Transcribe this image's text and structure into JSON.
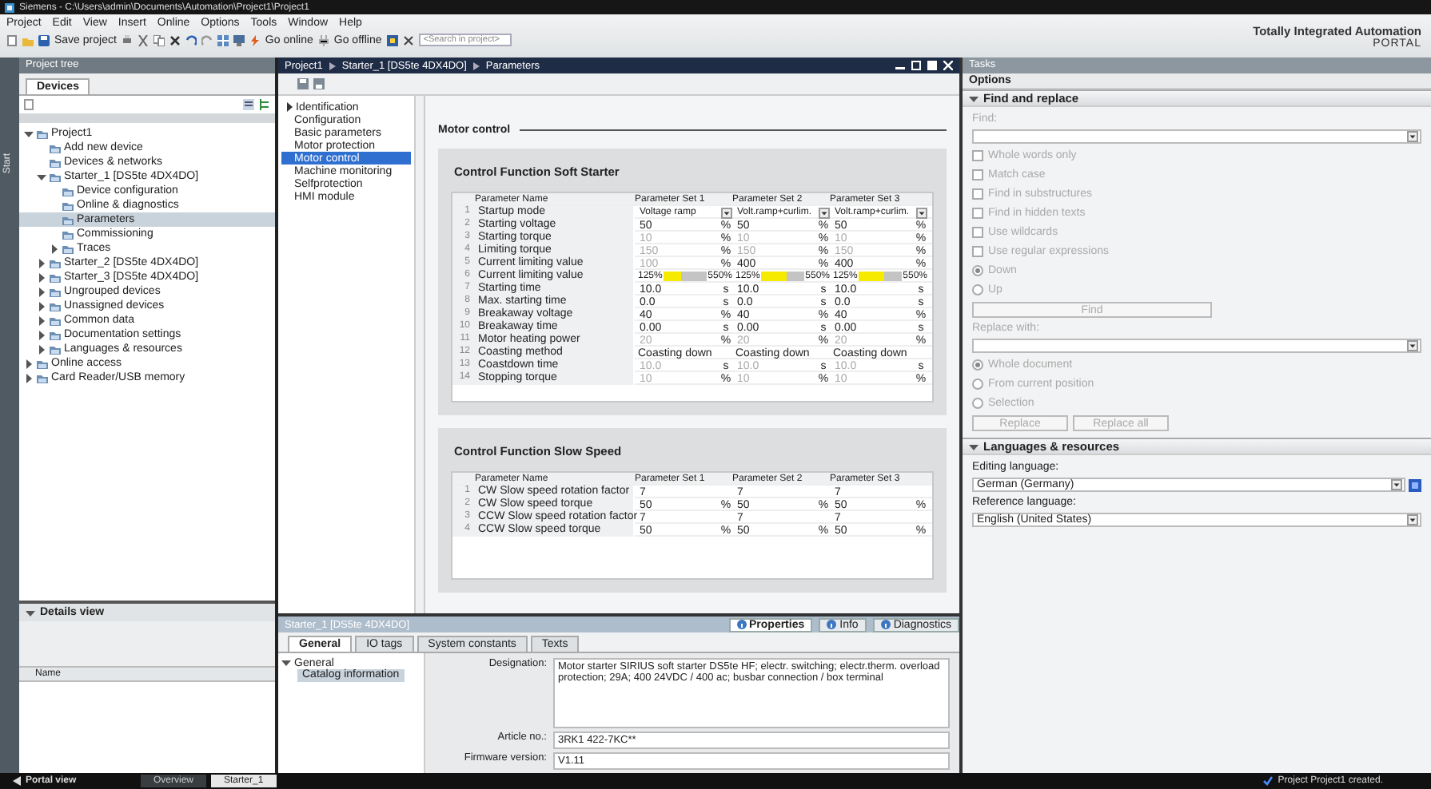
{
  "window": {
    "title": "Siemens - C:\\Users\\admin\\Documents\\Automation\\Project1\\Project1"
  },
  "menu": [
    "Project",
    "Edit",
    "View",
    "Insert",
    "Online",
    "Options",
    "Tools",
    "Window",
    "Help"
  ],
  "toolbar": {
    "save": "Save project",
    "go_online": "Go online",
    "go_offline": "Go offline",
    "search": {
      "placeholder": "<Search in project>"
    }
  },
  "brand": {
    "line1": "Totally Integrated Automation",
    "line2": "PORTAL"
  },
  "start_tab": "Start",
  "project_tree": {
    "title": "Project tree",
    "tabs": [
      {
        "label": "Devices",
        "selected": true
      }
    ],
    "items": [
      {
        "label": "Project1",
        "expanded": true,
        "selected": false,
        "children": [
          {
            "label": "Add new device",
            "selected": false
          },
          {
            "label": "Devices & networks",
            "selected": false
          },
          {
            "label": "Starter_1 [DS5te 4DX4DO]",
            "expanded": true,
            "selected": false,
            "children": [
              {
                "label": "Device configuration",
                "selected": false
              },
              {
                "label": "Online & diagnostics",
                "selected": false
              },
              {
                "label": "Parameters",
                "selected": true
              },
              {
                "label": "Commissioning",
                "selected": false
              },
              {
                "label": "Traces",
                "expanded": false,
                "selected": false
              }
            ]
          },
          {
            "label": "Starter_2 [DS5te 4DX4DO]",
            "expanded": false,
            "selected": false
          },
          {
            "label": "Starter_3 [DS5te 4DX4DO]",
            "expanded": false,
            "selected": false
          },
          {
            "label": "Ungrouped devices",
            "expanded": false,
            "selected": false
          },
          {
            "label": "Unassigned devices",
            "expanded": false,
            "selected": false
          },
          {
            "label": "Common data",
            "expanded": false,
            "selected": false
          },
          {
            "label": "Documentation settings",
            "expanded": false,
            "selected": false
          },
          {
            "label": "Languages & resources",
            "expanded": false,
            "selected": false
          }
        ]
      },
      {
        "label": "Online access",
        "expanded": false,
        "selected": false
      },
      {
        "label": "Card Reader/USB memory",
        "expanded": false,
        "selected": false
      }
    ]
  },
  "details_view": {
    "title": "Details view",
    "expanded": true,
    "columns": [
      "Name"
    ]
  },
  "editor": {
    "breadcrumb": [
      "Project1",
      "Starter_1 [DS5te 4DX4DO]",
      "Parameters"
    ],
    "nav": [
      {
        "label": "Identification",
        "expandable": true,
        "selected": false
      },
      {
        "label": "Configuration",
        "expandable": false,
        "selected": false
      },
      {
        "label": "Basic parameters",
        "expandable": false,
        "selected": false
      },
      {
        "label": "Motor protection",
        "expandable": false,
        "selected": false
      },
      {
        "label": "Motor control",
        "expandable": false,
        "selected": true
      },
      {
        "label": "Machine monitoring",
        "expandable": false,
        "selected": false
      },
      {
        "label": "Selfprotection",
        "expandable": false,
        "selected": false
      },
      {
        "label": "HMI module",
        "expandable": false,
        "selected": false
      }
    ],
    "heading": "Motor control",
    "sections": [
      {
        "title": "Control Function Soft Starter",
        "columns": [
          "Parameter Name",
          "Parameter Set 1",
          "Parameter Set 2",
          "Parameter Set 3"
        ],
        "rows": [
          {
            "no": "1",
            "name": "Startup mode",
            "kind": "dropdown",
            "sets": [
              {
                "value": "Voltage ramp"
              },
              {
                "value": "Volt.ramp+curlim."
              },
              {
                "value": "Volt.ramp+curlim."
              }
            ]
          },
          {
            "no": "2",
            "name": "Starting voltage",
            "kind": "value",
            "sets": [
              {
                "value": "50",
                "unit": "%",
                "disabled": false
              },
              {
                "value": "50",
                "unit": "%",
                "disabled": false
              },
              {
                "value": "50",
                "unit": "%",
                "disabled": false
              }
            ]
          },
          {
            "no": "3",
            "name": "Starting torque",
            "kind": "value",
            "sets": [
              {
                "value": "10",
                "unit": "%",
                "disabled": true
              },
              {
                "value": "10",
                "unit": "%",
                "disabled": true
              },
              {
                "value": "10",
                "unit": "%",
                "disabled": true
              }
            ]
          },
          {
            "no": "4",
            "name": "Limiting torque",
            "kind": "value",
            "sets": [
              {
                "value": "150",
                "unit": "%",
                "disabled": true
              },
              {
                "value": "150",
                "unit": "%",
                "disabled": true
              },
              {
                "value": "150",
                "unit": "%",
                "disabled": true
              }
            ]
          },
          {
            "no": "5",
            "name": "Current limiting value",
            "kind": "value",
            "sets": [
              {
                "value": "100",
                "unit": "%",
                "disabled": true
              },
              {
                "value": "400",
                "unit": "%",
                "disabled": false
              },
              {
                "value": "400",
                "unit": "%",
                "disabled": false
              }
            ]
          },
          {
            "no": "6",
            "name": "Current limiting value",
            "kind": "range",
            "sets": [
              {
                "min": "125%",
                "max": "550%",
                "level": 0.4
              },
              {
                "min": "125%",
                "max": "550%",
                "level": 0.6
              },
              {
                "min": "125%",
                "max": "550%",
                "level": 0.6
              }
            ]
          },
          {
            "no": "7",
            "name": "Starting time",
            "kind": "value",
            "sets": [
              {
                "value": "10.0",
                "unit": "s",
                "disabled": false
              },
              {
                "value": "10.0",
                "unit": "s",
                "disabled": false
              },
              {
                "value": "10.0",
                "unit": "s",
                "disabled": false
              }
            ]
          },
          {
            "no": "8",
            "name": "Max. starting time",
            "kind": "value",
            "sets": [
              {
                "value": "0.0",
                "unit": "s",
                "disabled": false
              },
              {
                "value": "0.0",
                "unit": "s",
                "disabled": false
              },
              {
                "value": "0.0",
                "unit": "s",
                "disabled": false
              }
            ]
          },
          {
            "no": "9",
            "name": "Breakaway voltage",
            "kind": "value",
            "sets": [
              {
                "value": "40",
                "unit": "%",
                "disabled": false
              },
              {
                "value": "40",
                "unit": "%",
                "disabled": false
              },
              {
                "value": "40",
                "unit": "%",
                "disabled": false
              }
            ]
          },
          {
            "no": "10",
            "name": "Breakaway time",
            "kind": "value",
            "sets": [
              {
                "value": "0.00",
                "unit": "s",
                "disabled": false
              },
              {
                "value": "0.00",
                "unit": "s",
                "disabled": false
              },
              {
                "value": "0.00",
                "unit": "s",
                "disabled": false
              }
            ]
          },
          {
            "no": "11",
            "name": "Motor heating power",
            "kind": "value",
            "sets": [
              {
                "value": "20",
                "unit": "%",
                "disabled": true
              },
              {
                "value": "20",
                "unit": "%",
                "disabled": true
              },
              {
                "value": "20",
                "unit": "%",
                "disabled": true
              }
            ]
          },
          {
            "no": "12",
            "name": "Coasting method",
            "kind": "text",
            "sets": [
              {
                "value": "Coasting down"
              },
              {
                "value": "Coasting down"
              },
              {
                "value": "Coasting down"
              }
            ]
          },
          {
            "no": "13",
            "name": "Coastdown time",
            "kind": "value",
            "sets": [
              {
                "value": "10.0",
                "unit": "s",
                "disabled": true
              },
              {
                "value": "10.0",
                "unit": "s",
                "disabled": true
              },
              {
                "value": "10.0",
                "unit": "s",
                "disabled": true
              }
            ]
          },
          {
            "no": "14",
            "name": "Stopping torque",
            "kind": "value",
            "sets": [
              {
                "value": "10",
                "unit": "%",
                "disabled": true
              },
              {
                "value": "10",
                "unit": "%",
                "disabled": true
              },
              {
                "value": "10",
                "unit": "%",
                "disabled": true
              }
            ]
          }
        ]
      },
      {
        "title": "Control Function Slow Speed",
        "columns": [
          "Parameter Name",
          "Parameter Set 1",
          "Parameter Set 2",
          "Parameter Set 3"
        ],
        "rows": [
          {
            "no": "1",
            "name": "CW Slow speed rotation factor",
            "kind": "value",
            "sets": [
              {
                "value": "7",
                "disabled": false
              },
              {
                "value": "7",
                "disabled": false
              },
              {
                "value": "7",
                "disabled": false
              }
            ]
          },
          {
            "no": "2",
            "name": "CW Slow speed torque",
            "kind": "value",
            "sets": [
              {
                "value": "50",
                "unit": "%",
                "disabled": false
              },
              {
                "value": "50",
                "unit": "%",
                "disabled": false
              },
              {
                "value": "50",
                "unit": "%",
                "disabled": false
              }
            ]
          },
          {
            "no": "3",
            "name": "CCW Slow speed rotation factor",
            "kind": "value",
            "sets": [
              {
                "value": "7",
                "disabled": false
              },
              {
                "value": "7",
                "disabled": false
              },
              {
                "value": "7",
                "disabled": false
              }
            ]
          },
          {
            "no": "4",
            "name": "CCW Slow speed torque",
            "kind": "value",
            "sets": [
              {
                "value": "50",
                "unit": "%",
                "disabled": false
              },
              {
                "value": "50",
                "unit": "%",
                "disabled": false
              },
              {
                "value": "50",
                "unit": "%",
                "disabled": false
              }
            ]
          }
        ]
      }
    ]
  },
  "inspector": {
    "title": "Starter_1 [DS5te 4DX4DO]",
    "views": [
      {
        "label": "Properties",
        "selected": true
      },
      {
        "label": "Info",
        "selected": false
      },
      {
        "label": "Diagnostics",
        "selected": false
      }
    ],
    "tabs": [
      {
        "label": "General",
        "selected": true
      },
      {
        "label": "IO tags",
        "selected": false
      },
      {
        "label": "System constants",
        "selected": false
      },
      {
        "label": "Texts",
        "selected": false
      }
    ],
    "nav": {
      "label": "General",
      "expanded": true,
      "children": [
        {
          "label": "Catalog information",
          "selected": true
        }
      ]
    },
    "fields": [
      {
        "label": "Designation:",
        "kind": "multiline",
        "value": "Motor starter SIRIUS soft starter DS5te HF; electr. switching; electr.therm. overload protection; 29A; 400 24VDC / 400 ac; busbar connection / box terminal"
      },
      {
        "label": "Article no.:",
        "kind": "line",
        "value": "3RK1 422-7KC**"
      },
      {
        "label": "Firmware version:",
        "kind": "line",
        "value": "V1.11"
      }
    ]
  },
  "tasks": {
    "title": "Tasks",
    "subtitle": "Options",
    "find_replace": {
      "title": "Find and replace",
      "expanded": true,
      "disabled": true,
      "find_label": "Find:",
      "checks": [
        {
          "label": "Whole words only",
          "checked": false
        },
        {
          "label": "Match case",
          "checked": false
        },
        {
          "label": "Find in substructures",
          "checked": false
        },
        {
          "label": "Find in hidden texts",
          "checked": false
        },
        {
          "label": "Use wildcards",
          "checked": false
        },
        {
          "label": "Use regular expressions",
          "checked": false
        }
      ],
      "directions": [
        {
          "label": "Down",
          "selected": true
        },
        {
          "label": "Up",
          "selected": false
        }
      ],
      "find_button": "Find",
      "replace_label": "Replace with:",
      "scopes": [
        {
          "label": "Whole document",
          "selected": true
        },
        {
          "label": "From current position",
          "selected": false
        },
        {
          "label": "Selection",
          "selected": false
        }
      ],
      "buttons": [
        "Replace",
        "Replace all"
      ]
    },
    "languages": {
      "title": "Languages & resources",
      "expanded": true,
      "editing_label": "Editing language:",
      "editing_value": "German (Germany)",
      "reference_label": "Reference language:",
      "reference_value": "English (United States)"
    }
  },
  "status_bar": {
    "portal": "Portal view",
    "tabs": [
      {
        "label": "Overview",
        "selected": false
      },
      {
        "label": "Starter_1",
        "selected": true
      }
    ],
    "message": "Project Project1 created."
  }
}
